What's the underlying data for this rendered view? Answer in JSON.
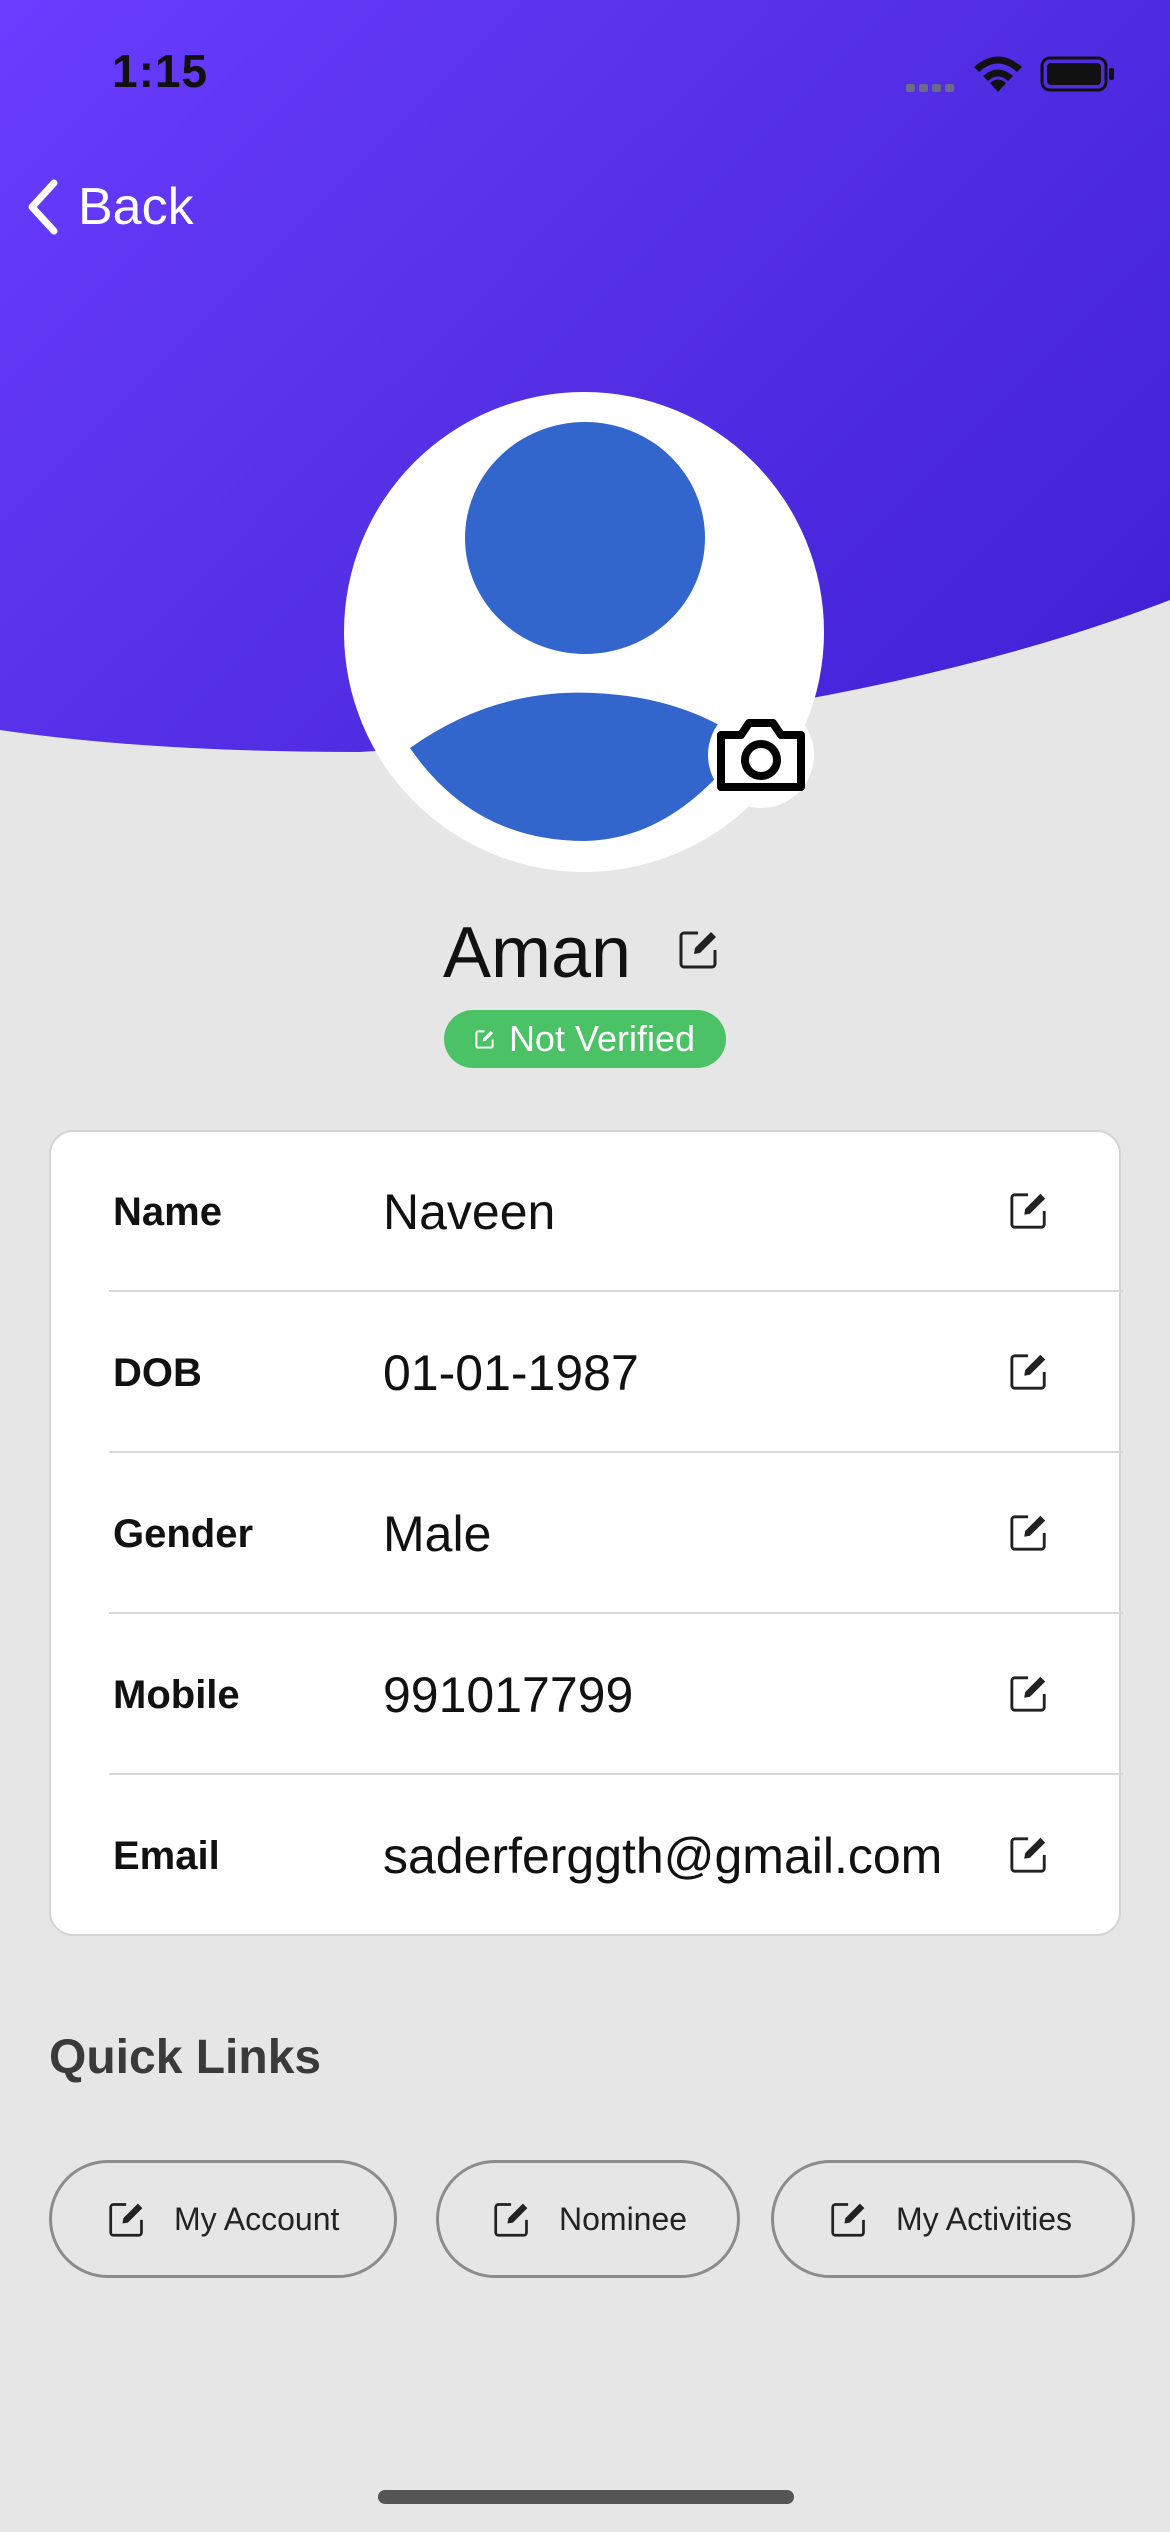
{
  "status_bar": {
    "time": "1:15",
    "icons": [
      "signal-icon",
      "wifi-icon",
      "battery-icon"
    ]
  },
  "nav": {
    "back_label": "Back",
    "back_icon": "chevron-left-icon"
  },
  "profile": {
    "name": "Aman",
    "verification_status": "Not Verified",
    "colors": {
      "hero_gradient": [
        "#6a3cff",
        "#3f1fd4"
      ],
      "avatar": "#3366cc",
      "badge": "#4cc266"
    }
  },
  "details": {
    "rows": [
      {
        "label": "Name",
        "value": "Naveen"
      },
      {
        "label": "DOB",
        "value": "01-01-1987"
      },
      {
        "label": "Gender",
        "value": "Male"
      },
      {
        "label": "Mobile",
        "value": "991017799"
      },
      {
        "label": "Email",
        "value": "saderferggth@gmail.com"
      }
    ]
  },
  "quick_links": {
    "title": "Quick Links",
    "items": [
      {
        "label": "My Account",
        "icon": "edit-icon"
      },
      {
        "label": "Nominee",
        "icon": "edit-icon"
      },
      {
        "label": "My Activities",
        "icon": "edit-icon"
      }
    ]
  }
}
